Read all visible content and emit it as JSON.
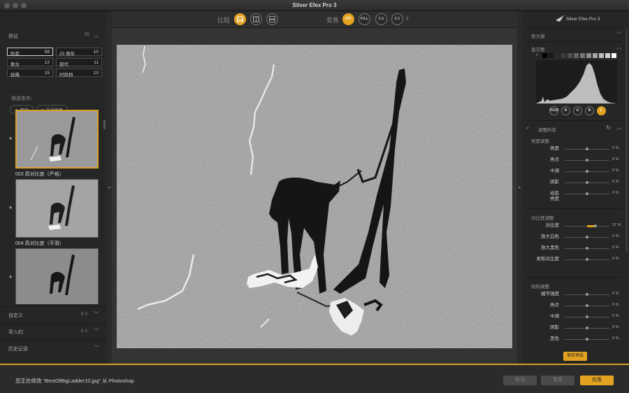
{
  "window": {
    "title": "Silver Efex Pro 3"
  },
  "left_panel": {
    "presets_label": "预设",
    "presets_count": "58",
    "categories": [
      {
        "name": "所有",
        "count": "58",
        "selected": true
      },
      {
        "name": "25 周年",
        "count": "10",
        "selected": false
      },
      {
        "name": "复古",
        "count": "12",
        "selected": false
      },
      {
        "name": "现代",
        "count": "11",
        "selected": false
      },
      {
        "name": "经典",
        "count": "15",
        "selected": false
      },
      {
        "name": "时尚档",
        "count": "10",
        "selected": false
      }
    ],
    "filter_label": "筛选条件:",
    "filter_pills": [
      "★ 喜爱",
      "⟳ 最近使用"
    ],
    "thumbnails": [
      {
        "label": "003 高对比度（严格）",
        "selected": true
      },
      {
        "label": "004 高对比度（平滑）",
        "selected": false
      },
      {
        "label": "",
        "selected": false
      }
    ],
    "sections": [
      {
        "label": "自定义",
        "count": "0 ⇕"
      },
      {
        "label": "导入的",
        "count": "0 ⇕"
      },
      {
        "label": "历史记录",
        "count": ""
      }
    ]
  },
  "toolbar": {
    "compare_label": "比较",
    "zoom_label": "变焦",
    "zoom_buttons": [
      "FIT",
      "FILL",
      "1:1",
      "2:1"
    ]
  },
  "right_panel": {
    "logo_text": "Silver Efex Pro 3",
    "loupe_label": "放大镜",
    "histogram_label": "直方图",
    "channels": [
      "RGB",
      "R",
      "G",
      "B",
      "L"
    ],
    "adjust_all_label": "调整所有",
    "groups": [
      {
        "title": "亮度调整",
        "sliders": [
          {
            "label": "亮度",
            "value": "0 %"
          },
          {
            "label": "亮点",
            "value": "0 %"
          },
          {
            "label": "中调",
            "value": "0 %"
          },
          {
            "label": "阴影",
            "value": "0 %"
          },
          {
            "label": "动态\n亮度",
            "value": "0 %"
          }
        ]
      },
      {
        "title": "对比度调整",
        "sliders": [
          {
            "label": "对比度",
            "value": "37 %"
          },
          {
            "label": "放大白色",
            "value": "0 %"
          },
          {
            "label": "放大黑色",
            "value": "0 %"
          },
          {
            "label": "柔和对比度",
            "value": "0 %"
          }
        ]
      },
      {
        "title": "结构调整",
        "sliders": [
          {
            "label": "细节强度",
            "value": "0 %"
          },
          {
            "label": "亮点",
            "value": "0 %"
          },
          {
            "label": "中调",
            "value": "0 %"
          },
          {
            "label": "阴影",
            "value": "0 %"
          },
          {
            "label": "黑色",
            "value": "0 %"
          }
        ]
      }
    ],
    "save_preset_label": "保存预设"
  },
  "bottom_bar": {
    "status": "您正在修改 “BestOfBigLadder10.jpg” 从 Photoshop",
    "buttons": [
      "取消",
      "重置",
      "应用"
    ]
  },
  "colors": {
    "accent": "#e3a321",
    "panel": "#262626",
    "canvas": "#343434"
  }
}
